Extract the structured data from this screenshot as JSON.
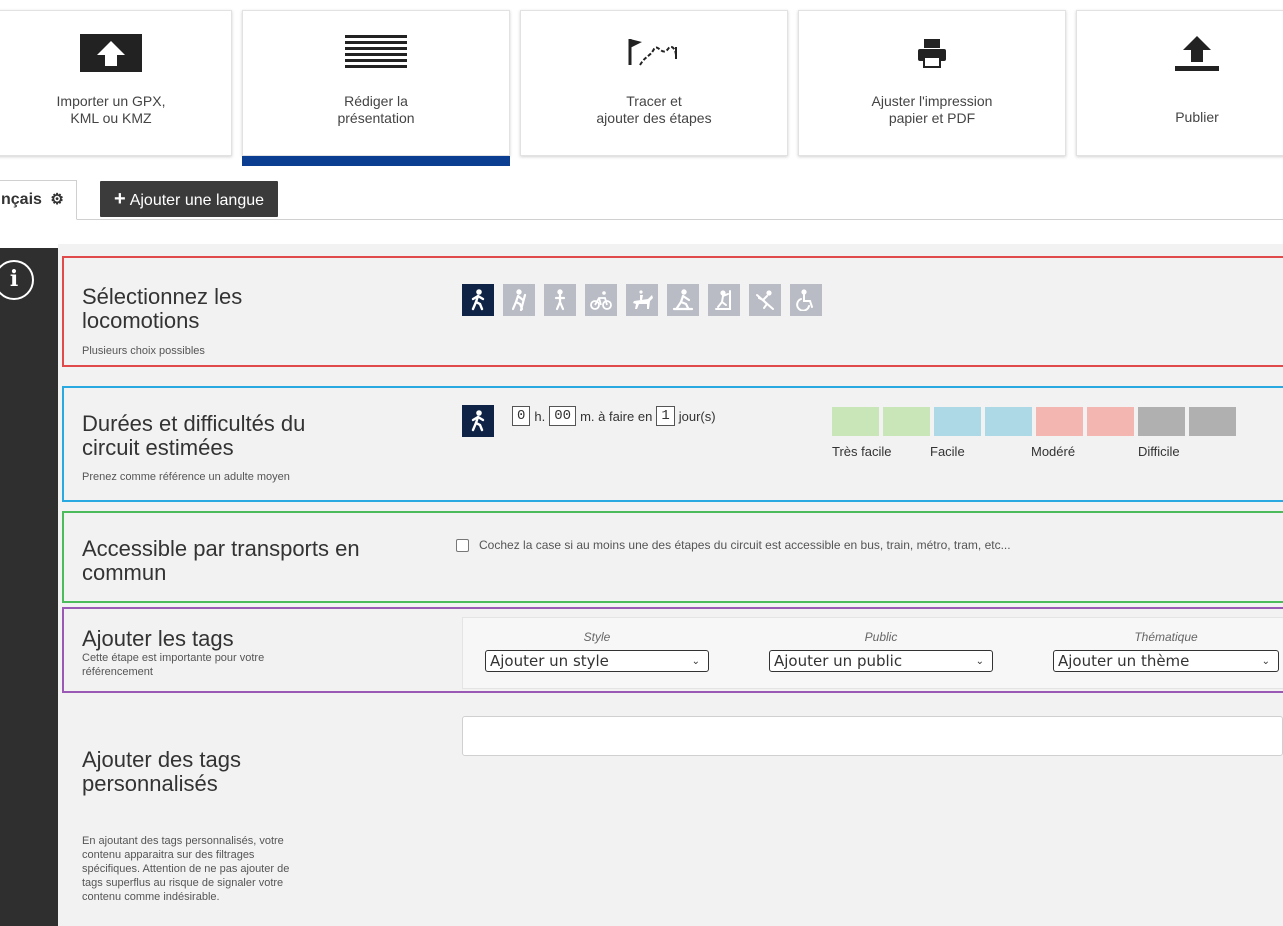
{
  "steps": [
    {
      "label": "Importer un GPX,\nKML ou KMZ",
      "icon": "upload-box-icon"
    },
    {
      "label": "Rédiger la\nprésentation",
      "icon": "text-lines-icon"
    },
    {
      "label": "Tracer et\najouter des étapes",
      "icon": "route-flag-icon"
    },
    {
      "label": "Ajuster l'impression\npapier et PDF",
      "icon": "printer-icon"
    },
    {
      "label": "Publier",
      "icon": "publish-upload-icon"
    }
  ],
  "active_step": 1,
  "language": {
    "current": "nçais",
    "add_label": "Ajouter une langue"
  },
  "locomotion": {
    "title": "Sélectionnez les\nlocomotions",
    "subtitle": "Plusieurs choix possibles",
    "icons": [
      "walking-icon",
      "hiking-icon",
      "running-icon",
      "cycling-icon",
      "horse-riding-icon",
      "snowshoe-icon",
      "climbing-icon",
      "skiing-icon",
      "wheelchair-icon"
    ],
    "selected": 0
  },
  "duration": {
    "title": "Durées et difficultés du\ncircuit estimées",
    "subtitle": "Prenez comme référence un adulte moyen",
    "hours": "0",
    "hours_unit": "h.",
    "minutes": "00",
    "minutes_unit": "m. à faire en",
    "days": "1",
    "days_unit": "jour(s)",
    "difficulty_labels": [
      "Très facile",
      "Facile",
      "Modéré",
      "Difficile"
    ],
    "difficulty_colors": [
      "#c8e6b8",
      "#add8e6",
      "#f4b6b0",
      "#b0b0b0"
    ]
  },
  "transport": {
    "title": "Accessible par transports en\ncommun",
    "checkbox_label": "Cochez la case si au moins une des étapes du circuit est accessible en bus, train, métro, tram, etc..."
  },
  "tags": {
    "title": "Ajouter les tags",
    "subtitle": "Cette étape est importante pour votre\nréférencement",
    "style_header": "Style",
    "style_value": "Ajouter un style",
    "public_header": "Public",
    "public_value": "Ajouter un public",
    "theme_header": "Thématique",
    "theme_value": "Ajouter un thème"
  },
  "custom_tags": {
    "title": "Ajouter des tags\npersonnalisés",
    "subtitle": "En ajoutant des tags personnalisés, votre\ncontenu apparaitra sur des filtrages\nspécifiques. Attention de ne pas ajouter de\ntags superflus au risque de signaler votre\ncontenu comme indésirable."
  }
}
